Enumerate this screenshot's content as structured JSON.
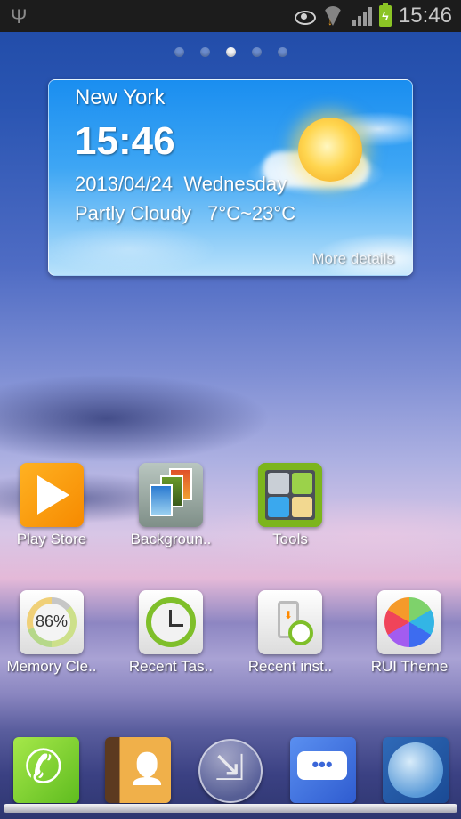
{
  "status_bar": {
    "usb_icon": "usb-icon",
    "icons": [
      "eye-icon",
      "wifi-icon",
      "signal-icon",
      "battery-charging-icon"
    ],
    "time": "15:46"
  },
  "home_pages": {
    "count": 5,
    "current": 3
  },
  "weather_widget": {
    "city": "New York",
    "time": "15:46",
    "date": "2013/04/24",
    "weekday": "Wednesday",
    "date_line": "2013/04/24  Wednesday",
    "condition": "Partly Cloudy",
    "temp_range": "7°C~23°C",
    "condition_line": "Partly Cloudy   7°C~23°C",
    "more_details": "More details",
    "weather_icon": "partly-cloudy-sun-icon"
  },
  "apps_row1": [
    {
      "label": "Play Store",
      "icon": "play-store-icon"
    },
    {
      "label": "Backgroun..",
      "icon": "backgrounds-icon"
    },
    {
      "label": "Tools",
      "icon": "tools-folder-icon"
    }
  ],
  "apps_row2": [
    {
      "label": "Memory Cle..",
      "icon": "memory-cleaner-icon",
      "value": "86%"
    },
    {
      "label": "Recent Tas..",
      "icon": "recent-tasks-icon"
    },
    {
      "label": "Recent inst..",
      "icon": "recent-installs-icon"
    },
    {
      "label": "RUI Theme",
      "icon": "rui-theme-icon"
    }
  ],
  "dock": [
    {
      "name": "phone",
      "icon": "phone-icon"
    },
    {
      "name": "contacts",
      "icon": "contacts-icon"
    },
    {
      "name": "app-switcher",
      "icon": "app-switcher-icon"
    },
    {
      "name": "messaging",
      "icon": "messaging-icon"
    },
    {
      "name": "browser",
      "icon": "globe-icon"
    }
  ]
}
